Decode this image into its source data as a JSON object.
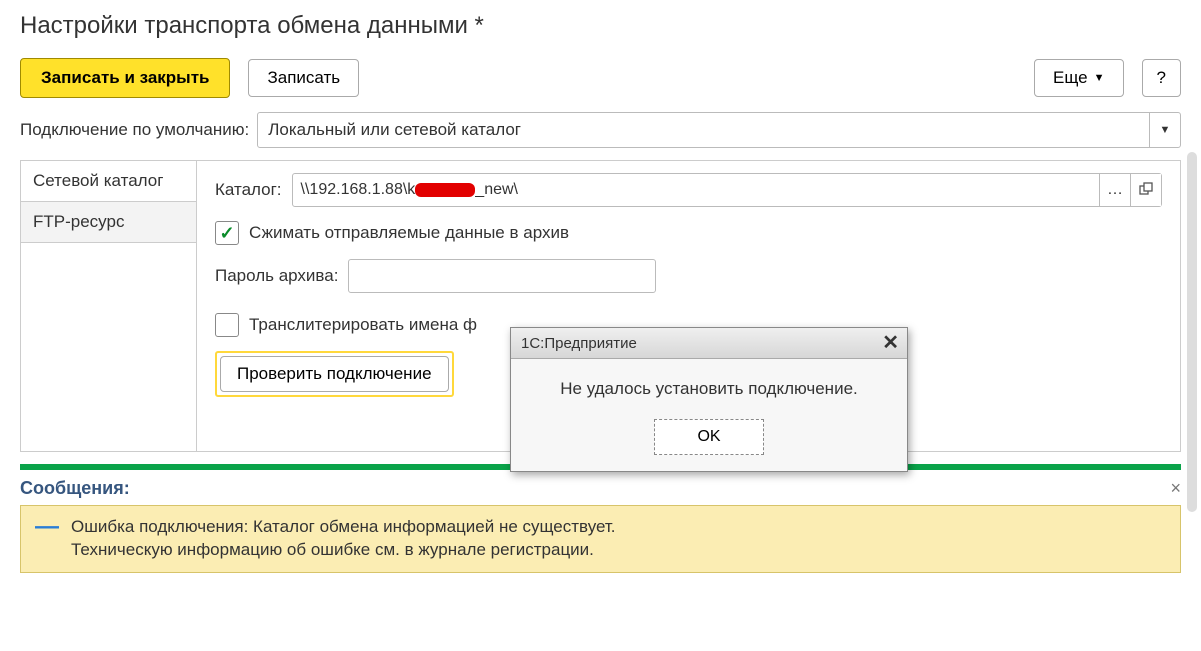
{
  "title": "Настройки транспорта обмена данными *",
  "toolbar": {
    "save_close": "Записать и закрыть",
    "save": "Записать",
    "more": "Еще",
    "help": "?"
  },
  "default_conn": {
    "label": "Подключение по умолчанию:",
    "value": "Локальный или сетевой каталог"
  },
  "tabs": {
    "network": "Сетевой каталог",
    "ftp": "FTP-ресурс"
  },
  "catalog": {
    "label": "Каталог:",
    "value_prefix": "\\\\192.168.1.88\\k",
    "value_suffix": "_new\\"
  },
  "compress": {
    "checked": true,
    "label": "Сжимать отправляемые данные в архив"
  },
  "archive_pwd": {
    "label": "Пароль архива:",
    "value": ""
  },
  "translit": {
    "checked": false,
    "label": "Транслитерировать имена ф"
  },
  "verify_btn": "Проверить подключение",
  "dialog": {
    "title": "1С:Предприятие",
    "message": "Не удалось установить подключение.",
    "ok": "OK"
  },
  "messages": {
    "header": "Сообщения:",
    "line1": "Ошибка подключения: Каталог обмена информацией не существует.",
    "line2": "Техническую информацию об ошибке см. в журнале регистрации."
  }
}
